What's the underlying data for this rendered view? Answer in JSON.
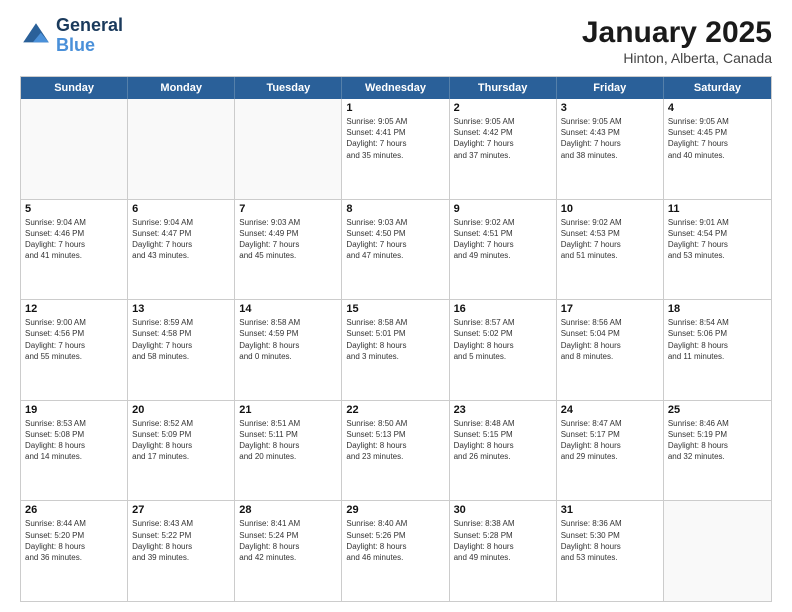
{
  "logo": {
    "line1": "General",
    "line2": "Blue"
  },
  "title": "January 2025",
  "subtitle": "Hinton, Alberta, Canada",
  "header_days": [
    "Sunday",
    "Monday",
    "Tuesday",
    "Wednesday",
    "Thursday",
    "Friday",
    "Saturday"
  ],
  "weeks": [
    [
      {
        "day": "",
        "info": ""
      },
      {
        "day": "",
        "info": ""
      },
      {
        "day": "",
        "info": ""
      },
      {
        "day": "1",
        "info": "Sunrise: 9:05 AM\nSunset: 4:41 PM\nDaylight: 7 hours\nand 35 minutes."
      },
      {
        "day": "2",
        "info": "Sunrise: 9:05 AM\nSunset: 4:42 PM\nDaylight: 7 hours\nand 37 minutes."
      },
      {
        "day": "3",
        "info": "Sunrise: 9:05 AM\nSunset: 4:43 PM\nDaylight: 7 hours\nand 38 minutes."
      },
      {
        "day": "4",
        "info": "Sunrise: 9:05 AM\nSunset: 4:45 PM\nDaylight: 7 hours\nand 40 minutes."
      }
    ],
    [
      {
        "day": "5",
        "info": "Sunrise: 9:04 AM\nSunset: 4:46 PM\nDaylight: 7 hours\nand 41 minutes."
      },
      {
        "day": "6",
        "info": "Sunrise: 9:04 AM\nSunset: 4:47 PM\nDaylight: 7 hours\nand 43 minutes."
      },
      {
        "day": "7",
        "info": "Sunrise: 9:03 AM\nSunset: 4:49 PM\nDaylight: 7 hours\nand 45 minutes."
      },
      {
        "day": "8",
        "info": "Sunrise: 9:03 AM\nSunset: 4:50 PM\nDaylight: 7 hours\nand 47 minutes."
      },
      {
        "day": "9",
        "info": "Sunrise: 9:02 AM\nSunset: 4:51 PM\nDaylight: 7 hours\nand 49 minutes."
      },
      {
        "day": "10",
        "info": "Sunrise: 9:02 AM\nSunset: 4:53 PM\nDaylight: 7 hours\nand 51 minutes."
      },
      {
        "day": "11",
        "info": "Sunrise: 9:01 AM\nSunset: 4:54 PM\nDaylight: 7 hours\nand 53 minutes."
      }
    ],
    [
      {
        "day": "12",
        "info": "Sunrise: 9:00 AM\nSunset: 4:56 PM\nDaylight: 7 hours\nand 55 minutes."
      },
      {
        "day": "13",
        "info": "Sunrise: 8:59 AM\nSunset: 4:58 PM\nDaylight: 7 hours\nand 58 minutes."
      },
      {
        "day": "14",
        "info": "Sunrise: 8:58 AM\nSunset: 4:59 PM\nDaylight: 8 hours\nand 0 minutes."
      },
      {
        "day": "15",
        "info": "Sunrise: 8:58 AM\nSunset: 5:01 PM\nDaylight: 8 hours\nand 3 minutes."
      },
      {
        "day": "16",
        "info": "Sunrise: 8:57 AM\nSunset: 5:02 PM\nDaylight: 8 hours\nand 5 minutes."
      },
      {
        "day": "17",
        "info": "Sunrise: 8:56 AM\nSunset: 5:04 PM\nDaylight: 8 hours\nand 8 minutes."
      },
      {
        "day": "18",
        "info": "Sunrise: 8:54 AM\nSunset: 5:06 PM\nDaylight: 8 hours\nand 11 minutes."
      }
    ],
    [
      {
        "day": "19",
        "info": "Sunrise: 8:53 AM\nSunset: 5:08 PM\nDaylight: 8 hours\nand 14 minutes."
      },
      {
        "day": "20",
        "info": "Sunrise: 8:52 AM\nSunset: 5:09 PM\nDaylight: 8 hours\nand 17 minutes."
      },
      {
        "day": "21",
        "info": "Sunrise: 8:51 AM\nSunset: 5:11 PM\nDaylight: 8 hours\nand 20 minutes."
      },
      {
        "day": "22",
        "info": "Sunrise: 8:50 AM\nSunset: 5:13 PM\nDaylight: 8 hours\nand 23 minutes."
      },
      {
        "day": "23",
        "info": "Sunrise: 8:48 AM\nSunset: 5:15 PM\nDaylight: 8 hours\nand 26 minutes."
      },
      {
        "day": "24",
        "info": "Sunrise: 8:47 AM\nSunset: 5:17 PM\nDaylight: 8 hours\nand 29 minutes."
      },
      {
        "day": "25",
        "info": "Sunrise: 8:46 AM\nSunset: 5:19 PM\nDaylight: 8 hours\nand 32 minutes."
      }
    ],
    [
      {
        "day": "26",
        "info": "Sunrise: 8:44 AM\nSunset: 5:20 PM\nDaylight: 8 hours\nand 36 minutes."
      },
      {
        "day": "27",
        "info": "Sunrise: 8:43 AM\nSunset: 5:22 PM\nDaylight: 8 hours\nand 39 minutes."
      },
      {
        "day": "28",
        "info": "Sunrise: 8:41 AM\nSunset: 5:24 PM\nDaylight: 8 hours\nand 42 minutes."
      },
      {
        "day": "29",
        "info": "Sunrise: 8:40 AM\nSunset: 5:26 PM\nDaylight: 8 hours\nand 46 minutes."
      },
      {
        "day": "30",
        "info": "Sunrise: 8:38 AM\nSunset: 5:28 PM\nDaylight: 8 hours\nand 49 minutes."
      },
      {
        "day": "31",
        "info": "Sunrise: 8:36 AM\nSunset: 5:30 PM\nDaylight: 8 hours\nand 53 minutes."
      },
      {
        "day": "",
        "info": ""
      }
    ]
  ]
}
